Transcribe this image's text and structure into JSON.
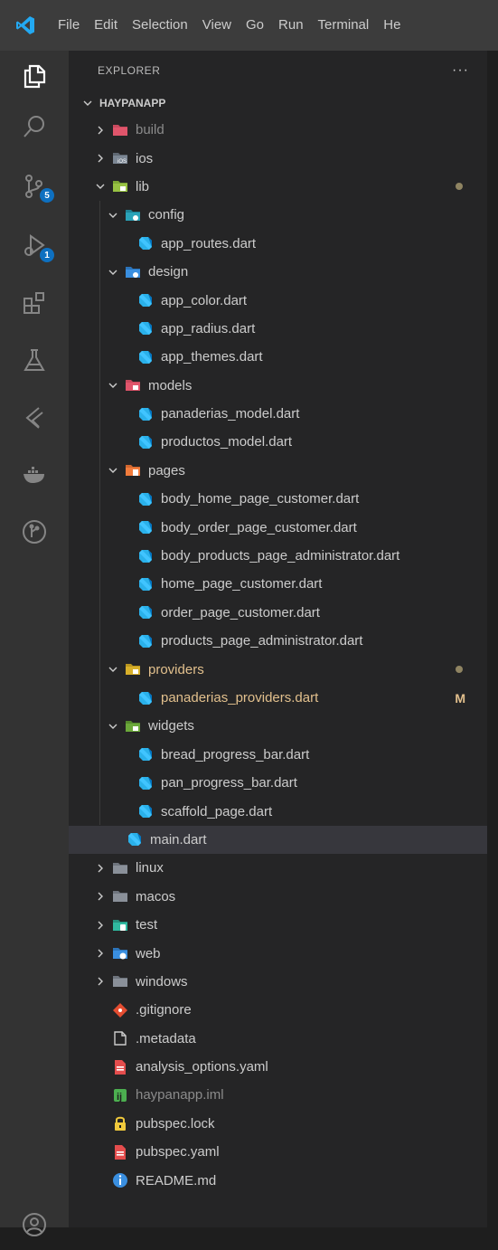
{
  "menu": [
    "File",
    "Edit",
    "Selection",
    "View",
    "Go",
    "Run",
    "Terminal",
    "He"
  ],
  "activity": {
    "items": [
      "explorer-icon",
      "search-icon",
      "source-control-icon",
      "run-debug-icon",
      "extensions-icon",
      "testing-icon",
      "flutter-icon",
      "docker-icon",
      "git-graph-icon"
    ],
    "source_control_badge": "5",
    "run_debug_badge": "1",
    "bottom": "account-icon"
  },
  "sidebar": {
    "title": "EXPLORER",
    "more": "···",
    "root": "HAYPANAPP"
  },
  "tree": [
    {
      "label": "build",
      "depth": 0,
      "kind": "folder",
      "icon": "build",
      "open": false,
      "muted": true
    },
    {
      "label": "ios",
      "depth": 0,
      "kind": "folder",
      "icon": "ios",
      "open": false
    },
    {
      "label": "lib",
      "depth": 0,
      "kind": "folder",
      "icon": "lib",
      "open": true,
      "dot": true
    },
    {
      "label": "config",
      "depth": 1,
      "kind": "folder",
      "icon": "config",
      "open": true
    },
    {
      "label": "app_routes.dart",
      "depth": 2,
      "kind": "dart"
    },
    {
      "label": "design",
      "depth": 1,
      "kind": "folder",
      "icon": "design",
      "open": true
    },
    {
      "label": "app_color.dart",
      "depth": 2,
      "kind": "dart"
    },
    {
      "label": "app_radius.dart",
      "depth": 2,
      "kind": "dart"
    },
    {
      "label": "app_themes.dart",
      "depth": 2,
      "kind": "dart"
    },
    {
      "label": "models",
      "depth": 1,
      "kind": "folder",
      "icon": "models",
      "open": true
    },
    {
      "label": "panaderias_model.dart",
      "depth": 2,
      "kind": "dart"
    },
    {
      "label": "productos_model.dart",
      "depth": 2,
      "kind": "dart"
    },
    {
      "label": "pages",
      "depth": 1,
      "kind": "folder",
      "icon": "pages",
      "open": true
    },
    {
      "label": "body_home_page_customer.dart",
      "depth": 2,
      "kind": "dart"
    },
    {
      "label": "body_order_page_customer.dart",
      "depth": 2,
      "kind": "dart"
    },
    {
      "label": "body_products_page_administrator.dart",
      "depth": 2,
      "kind": "dart"
    },
    {
      "label": "home_page_customer.dart",
      "depth": 2,
      "kind": "dart"
    },
    {
      "label": "order_page_customer.dart",
      "depth": 2,
      "kind": "dart"
    },
    {
      "label": "products_page_administrator.dart",
      "depth": 2,
      "kind": "dart"
    },
    {
      "label": "providers",
      "depth": 1,
      "kind": "folder",
      "icon": "providers",
      "open": true,
      "modified": true,
      "dot": true
    },
    {
      "label": "panaderias_providers.dart",
      "depth": 2,
      "kind": "dart",
      "modified": true,
      "flag": "M"
    },
    {
      "label": "widgets",
      "depth": 1,
      "kind": "folder",
      "icon": "widgets",
      "open": true
    },
    {
      "label": "bread_progress_bar.dart",
      "depth": 2,
      "kind": "dart"
    },
    {
      "label": "pan_progress_bar.dart",
      "depth": 2,
      "kind": "dart"
    },
    {
      "label": "scaffold_page.dart",
      "depth": 2,
      "kind": "dart"
    },
    {
      "label": "main.dart",
      "depth": 1,
      "kind": "dart",
      "selected": true
    },
    {
      "label": "linux",
      "depth": 0,
      "kind": "folder",
      "icon": "plain",
      "open": false
    },
    {
      "label": "macos",
      "depth": 0,
      "kind": "folder",
      "icon": "plain",
      "open": false
    },
    {
      "label": "test",
      "depth": 0,
      "kind": "folder",
      "icon": "test",
      "open": false
    },
    {
      "label": "web",
      "depth": 0,
      "kind": "folder",
      "icon": "web",
      "open": false
    },
    {
      "label": "windows",
      "depth": 0,
      "kind": "folder",
      "icon": "plain",
      "open": false
    },
    {
      "label": ".gitignore",
      "depth": 0,
      "kind": "gitignore"
    },
    {
      "label": ".metadata",
      "depth": 0,
      "kind": "metadata"
    },
    {
      "label": "analysis_options.yaml",
      "depth": 0,
      "kind": "yaml"
    },
    {
      "label": "haypanapp.iml",
      "depth": 0,
      "kind": "iml",
      "muted": true
    },
    {
      "label": "pubspec.lock",
      "depth": 0,
      "kind": "lock"
    },
    {
      "label": "pubspec.yaml",
      "depth": 0,
      "kind": "yaml"
    },
    {
      "label": "README.md",
      "depth": 0,
      "kind": "readme"
    }
  ],
  "colors": {
    "folder_gray": "#8a9099",
    "dart": "#2ab1ea",
    "modified": "#e2c08d",
    "muted": "#8b8b8b"
  }
}
